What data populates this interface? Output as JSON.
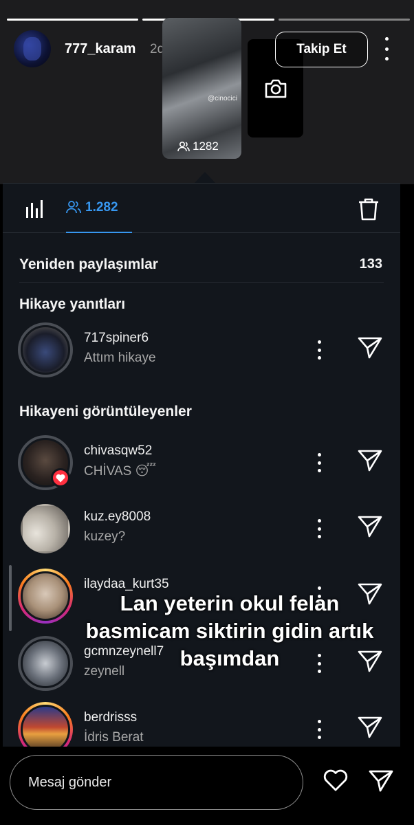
{
  "story": {
    "username": "777_karam",
    "time": "2d",
    "follow_label": "Takip Et",
    "thumb_watermark": "@cinocici",
    "thumb_views": "1282"
  },
  "tabs": {
    "viewers_count": "1.282"
  },
  "reshares": {
    "label": "Yeniden paylaşımlar",
    "count": "133"
  },
  "replies": {
    "title": "Hikaye yanıtları",
    "items": [
      {
        "username": "717spiner6",
        "text": "Attım hikaye"
      }
    ]
  },
  "viewers": {
    "title": "Hikayeni görüntüleyenler",
    "items": [
      {
        "username": "chivasqw52",
        "text": "CHİVAS 😴",
        "liked": true
      },
      {
        "username": "kuz.ey8008",
        "text": "kuzey?"
      },
      {
        "username": "ilaydaa_kurt35",
        "text": ""
      },
      {
        "username": "gcmnzeynell7",
        "text": "zeynell"
      },
      {
        "username": "berdrisss",
        "text": "İdris Berat"
      }
    ]
  },
  "overlay": {
    "line1": "Lan yeterin okul felan",
    "line2": "basmicam siktirin gidin artık",
    "line3": "başımdan"
  },
  "composer": {
    "placeholder": "Mesaj gönder"
  },
  "colors": {
    "accent": "#3797f0",
    "like_badge": "#ff3040"
  }
}
